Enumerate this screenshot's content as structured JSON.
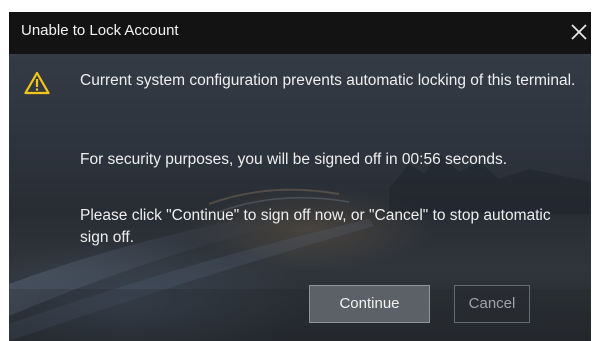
{
  "dialog": {
    "title": "Unable to Lock Account",
    "close_icon": "close-icon",
    "warning_icon": "warning-icon",
    "message_1": "Current system configuration prevents automatic locking of this terminal.",
    "message_2": "For security purposes, you will be signed off in 00:56 seconds.",
    "message_3": "Please click \"Continue\" to sign off now, or \"Cancel\" to stop automatic sign off.",
    "continue_label": "Continue",
    "cancel_label": "Cancel"
  },
  "colors": {
    "titlebar": "#131313",
    "warning_yellow": "#f5c518",
    "continue_bg": "#5c6167",
    "cancel_text": "#9fa3a8"
  }
}
